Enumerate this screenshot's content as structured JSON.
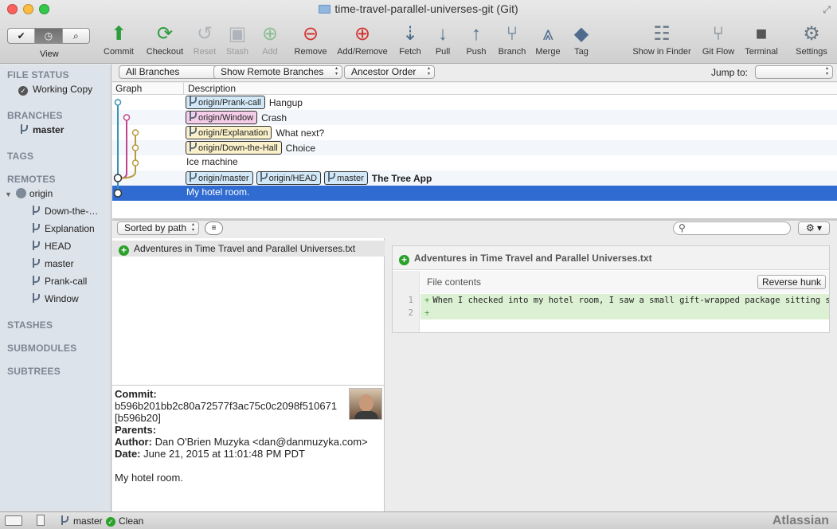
{
  "window": {
    "title": "time-travel-parallel-universes-git (Git)"
  },
  "toolbar": {
    "view_label": "View",
    "buttons": [
      {
        "label": "Commit",
        "icon": "commit-icon",
        "enabled": true
      },
      {
        "label": "Checkout",
        "icon": "checkout-icon",
        "enabled": true
      },
      {
        "label": "Reset",
        "icon": "reset-icon",
        "enabled": false
      },
      {
        "label": "Stash",
        "icon": "stash-icon",
        "enabled": false
      },
      {
        "label": "Add",
        "icon": "add-icon",
        "enabled": false
      },
      {
        "label": "Remove",
        "icon": "remove-icon",
        "enabled": true
      },
      {
        "label": "Add/Remove",
        "icon": "add-remove-icon",
        "enabled": true
      },
      {
        "label": "Fetch",
        "icon": "fetch-icon",
        "enabled": true
      },
      {
        "label": "Pull",
        "icon": "pull-icon",
        "enabled": true
      },
      {
        "label": "Push",
        "icon": "push-icon",
        "enabled": true
      },
      {
        "label": "Branch",
        "icon": "branch-icon",
        "enabled": true
      },
      {
        "label": "Merge",
        "icon": "merge-icon",
        "enabled": true
      },
      {
        "label": "Tag",
        "icon": "tag-icon",
        "enabled": true
      },
      {
        "label": "Show in Finder",
        "icon": "finder-icon",
        "enabled": true
      },
      {
        "label": "Git Flow",
        "icon": "git-flow-icon",
        "enabled": true
      },
      {
        "label": "Terminal",
        "icon": "terminal-icon",
        "enabled": true
      },
      {
        "label": "Settings",
        "icon": "settings-gear-icon",
        "enabled": true
      }
    ]
  },
  "sidebar": {
    "file_status": "FILE STATUS",
    "working_copy": "Working Copy",
    "branches_header": "BRANCHES",
    "current_branch": "master",
    "tags_header": "TAGS",
    "remotes_header": "REMOTES",
    "remote_name": "origin",
    "remote_branches": [
      "Down-the-…",
      "Explanation",
      "HEAD",
      "master",
      "Prank-call",
      "Window"
    ],
    "stashes_header": "STASHES",
    "submodules_header": "SUBMODULES",
    "subtrees_header": "SUBTREES"
  },
  "filters": {
    "branches": "All Branches",
    "remote": "Show Remote Branches",
    "order": "Ancestor Order",
    "jump_label": "Jump to:"
  },
  "columns": {
    "graph": "Graph",
    "description": "Description"
  },
  "commits": [
    {
      "tags": [
        {
          "text": "origin/Prank-call",
          "color": "#d3e8f6"
        }
      ],
      "message": "Hangup",
      "bold": false
    },
    {
      "tags": [
        {
          "text": "origin/Window",
          "color": "#f5cde9"
        }
      ],
      "message": "Crash",
      "bold": false
    },
    {
      "tags": [
        {
          "text": "origin/Explanation",
          "color": "#faf0c9"
        }
      ],
      "message": "What next?",
      "bold": false
    },
    {
      "tags": [
        {
          "text": "origin/Down-the-Hall",
          "color": "#faf0c9"
        }
      ],
      "message": "Choice",
      "bold": false
    },
    {
      "tags": [],
      "message": "Ice machine",
      "bold": false
    },
    {
      "tags": [
        {
          "text": "origin/master",
          "color": "#d3e8f6"
        },
        {
          "text": "origin/HEAD",
          "color": "#d3e8f6"
        },
        {
          "text": "master",
          "color": "#d3e8f6"
        }
      ],
      "message": "The Tree App",
      "bold": true
    },
    {
      "tags": [],
      "message": "My hotel room.",
      "bold": false,
      "selected": true
    }
  ],
  "file_toolbar": {
    "sort": "Sorted by path"
  },
  "files": [
    {
      "name": "Adventures in Time Travel and Parallel Universes.txt",
      "status": "added"
    }
  ],
  "diff": {
    "file": "Adventures in Time Travel and Parallel Universes.txt",
    "hunk_header": "File contents",
    "reverse_label": "Reverse hunk",
    "lines": [
      {
        "n": "1",
        "text": "When I checked into my hotel room, I saw a small gift-wrapped package sitting squar"
      },
      {
        "n": "2",
        "text": ""
      }
    ]
  },
  "commit_info": {
    "commit_label": "Commit:",
    "hash": "b596b201bb2c80a72577f3ac75c0c2098f510671",
    "short_hash": "[b596b20]",
    "parents_label": "Parents:",
    "author_label": "Author:",
    "author": "Dan O'Brien Muzyka <dan@danmuzyka.com>",
    "date_label": "Date:",
    "date": "June 21, 2015 at 11:01:48 PM PDT",
    "message": "My hotel room."
  },
  "status": {
    "branch": "master",
    "state": "Clean",
    "brand": "Atlassian"
  }
}
